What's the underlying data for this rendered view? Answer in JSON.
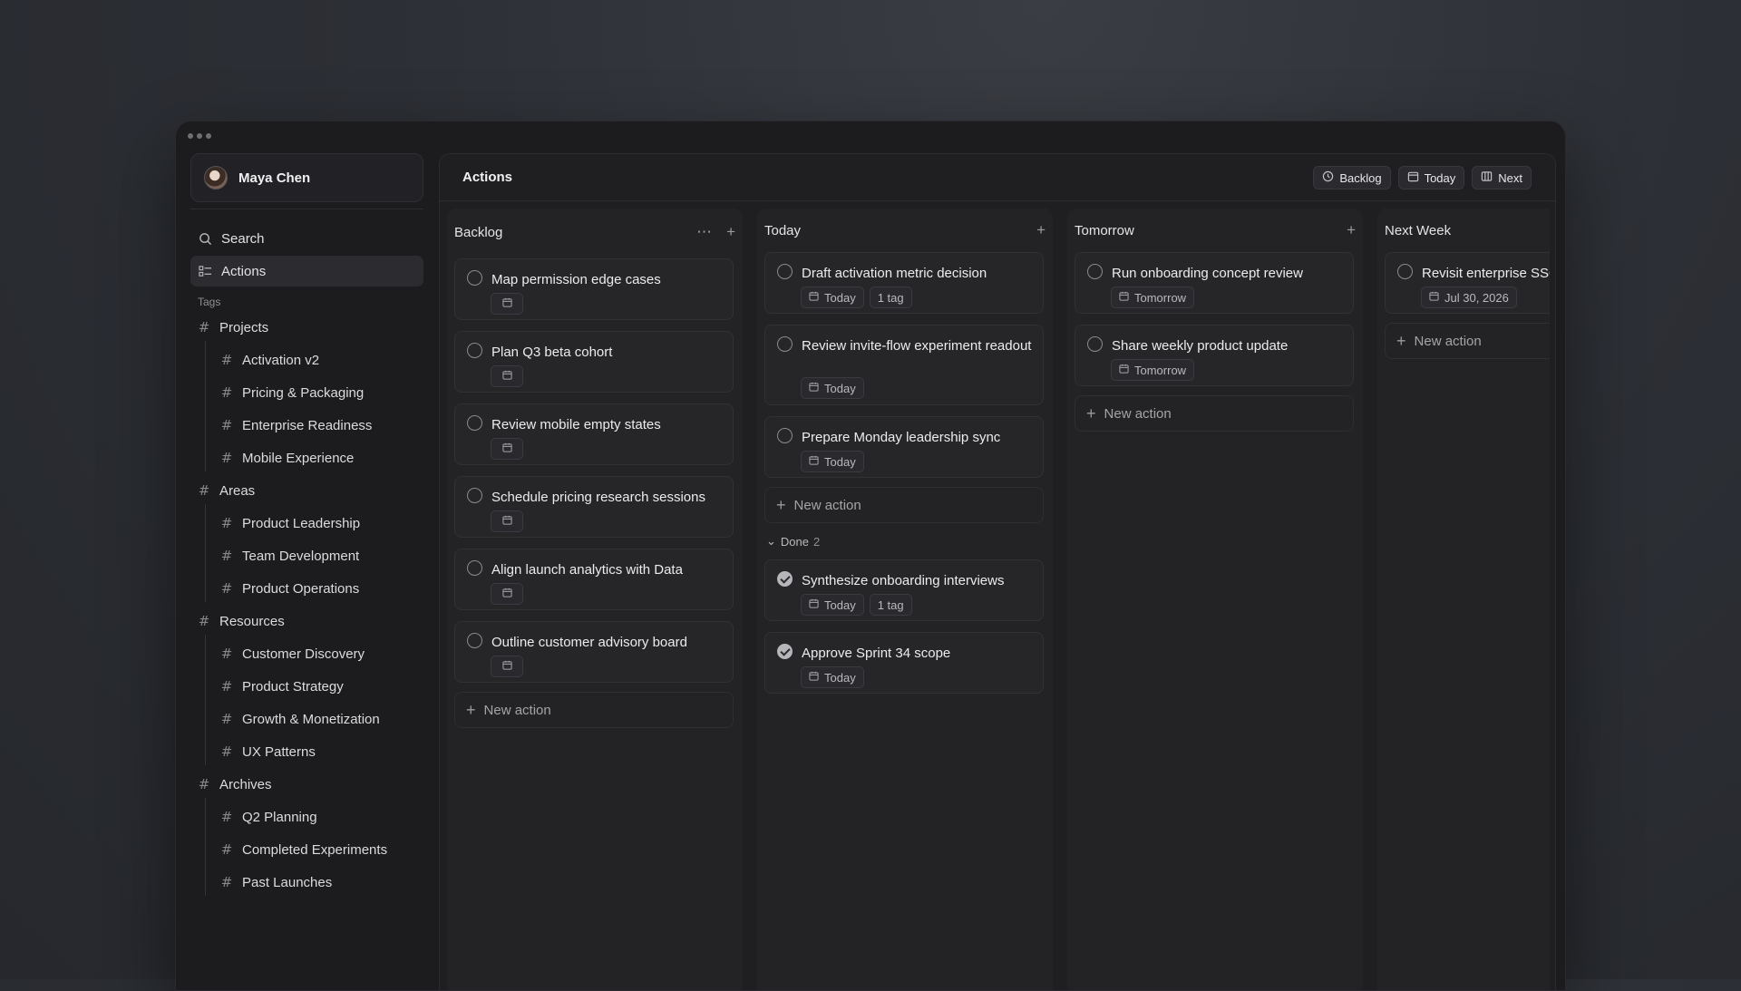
{
  "user": {
    "name": "Maya Chen"
  },
  "nav": {
    "search": "Search",
    "actions": "Actions"
  },
  "tags_label": "Tags",
  "tag_groups": [
    {
      "name": "Projects",
      "children": [
        "Activation v2",
        "Pricing & Packaging",
        "Enterprise Readiness",
        "Mobile Experience"
      ]
    },
    {
      "name": "Areas",
      "children": [
        "Product Leadership",
        "Team Development",
        "Product Operations"
      ]
    },
    {
      "name": "Resources",
      "children": [
        "Customer Discovery",
        "Product Strategy",
        "Growth & Monetization",
        "UX Patterns"
      ]
    },
    {
      "name": "Archives",
      "children": [
        "Q2 Planning",
        "Completed Experiments",
        "Past Launches"
      ]
    }
  ],
  "header": {
    "title": "Actions",
    "views": [
      {
        "label": "Backlog",
        "icon": "clock-icon"
      },
      {
        "label": "Today",
        "icon": "calendar-icon"
      },
      {
        "label": "Next",
        "icon": "columns-icon"
      }
    ]
  },
  "new_action_label": "New action",
  "columns": {
    "backlog": {
      "title": "Backlog",
      "cards": [
        {
          "title": "Map permission edge cases"
        },
        {
          "title": "Plan Q3 beta cohort"
        },
        {
          "title": "Review mobile empty states"
        },
        {
          "title": "Schedule pricing research sessions"
        },
        {
          "title": "Align launch analytics with Data"
        },
        {
          "title": "Outline customer advisory board"
        }
      ]
    },
    "today": {
      "title": "Today",
      "cards": [
        {
          "title": "Draft activation metric decision",
          "date": "Today",
          "tag": "1 tag"
        },
        {
          "title": "Review invite-flow experiment readout",
          "date": "Today"
        },
        {
          "title": "Prepare Monday leadership sync",
          "date": "Today"
        }
      ],
      "done_label": "Done",
      "done_count": "2",
      "done_cards": [
        {
          "title": "Synthesize onboarding interviews",
          "date": "Today",
          "tag": "1 tag"
        },
        {
          "title": "Approve Sprint 34 scope",
          "date": "Today"
        }
      ]
    },
    "tomorrow": {
      "title": "Tomorrow",
      "cards": [
        {
          "title": "Run onboarding concept review",
          "date": "Tomorrow"
        },
        {
          "title": "Share weekly product update",
          "date": "Tomorrow"
        }
      ]
    },
    "next_week": {
      "title": "Next Week",
      "cards": [
        {
          "title": "Revisit enterprise SSO",
          "date": "Jul 30, 2026"
        }
      ]
    }
  }
}
